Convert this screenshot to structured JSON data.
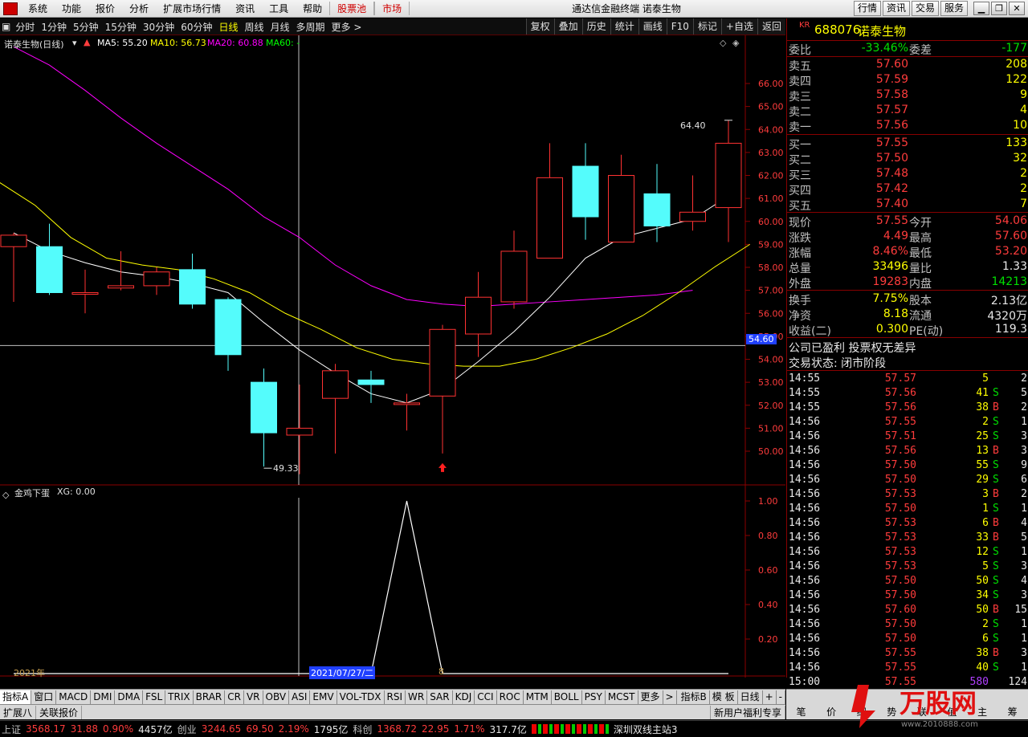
{
  "menu": {
    "items": [
      "系统",
      "功能",
      "报价",
      "分析",
      "扩展市场行情",
      "资讯",
      "工具",
      "帮助"
    ],
    "highlight": [
      "股票池",
      "市场"
    ],
    "app_title": "通达信金融终端  诺泰生物",
    "right_buttons": [
      "行情",
      "资讯",
      "交易",
      "服务"
    ]
  },
  "period_bar": {
    "items": [
      "分时",
      "1分钟",
      "5分钟",
      "15分钟",
      "30分钟",
      "60分钟",
      "日线",
      "周线",
      "月线",
      "多周期",
      "更多 >"
    ],
    "active": "日线",
    "tools": [
      "复权",
      "叠加",
      "历史",
      "统计",
      "画线",
      "F10",
      "标记",
      "+自选",
      "返回"
    ]
  },
  "chart_header": {
    "name": "诺泰生物(日线)",
    "ma5": "MA5: 55.20",
    "ma10": "MA10: 56.73",
    "ma20": "MA20: 60.88",
    "ma60": "MA60: -"
  },
  "indicator_header": {
    "name": "金鸡下蛋",
    "xg": "XG: 0.00"
  },
  "labels": {
    "high_marker": "64.40",
    "low_marker": "49.33",
    "cursor_price": "54.60",
    "year": "2021年",
    "cursor_date": "2021/07/27/二",
    "x_tick": "8",
    "period_label": "日线"
  },
  "colors": {
    "up": "#ff3232",
    "down": "#54fcfc",
    "ma5": "#ffffff",
    "ma10": "#ffff00",
    "ma20": "#ff00ff"
  },
  "chart_data": {
    "type": "candlestick",
    "y_ticks": [
      50.0,
      51.0,
      52.0,
      53.0,
      54.0,
      55.0,
      56.0,
      57.0,
      58.0,
      59.0,
      60.0,
      61.0,
      62.0,
      63.0,
      64.0,
      65.0,
      66.0
    ],
    "candles": [
      {
        "o": 58.9,
        "c": 59.4,
        "h": 59.5,
        "l": 56.5
      },
      {
        "o": 58.9,
        "c": 56.9,
        "h": 59.9,
        "l": 56.8
      },
      {
        "o": 56.9,
        "c": 56.9,
        "h": 57.9,
        "l": 56.0
      },
      {
        "o": 57.1,
        "c": 57.2,
        "h": 58.7,
        "l": 57.0
      },
      {
        "o": 57.2,
        "c": 57.8,
        "h": 58.0,
        "l": 56.8
      },
      {
        "o": 57.9,
        "c": 56.4,
        "h": 58.6,
        "l": 56.2
      },
      {
        "o": 56.6,
        "c": 54.2,
        "h": 56.7,
        "l": 53.5
      },
      {
        "o": 53.0,
        "c": 50.8,
        "h": 53.6,
        "l": 49.33
      },
      {
        "o": 50.7,
        "c": 51.0,
        "h": 52.9,
        "l": 49.0
      },
      {
        "o": 52.3,
        "c": 53.5,
        "h": 53.8,
        "l": 49.9
      },
      {
        "o": 53.1,
        "c": 52.9,
        "h": 53.5,
        "l": 52.1
      },
      {
        "o": 52.1,
        "c": 52.1,
        "h": 52.5,
        "l": 50.9
      },
      {
        "o": 52.4,
        "c": 55.3,
        "h": 55.5,
        "l": 49.9
      },
      {
        "o": 55.1,
        "c": 56.7,
        "h": 57.8,
        "l": 54.1
      },
      {
        "o": 56.5,
        "c": 58.7,
        "h": 59.6,
        "l": 56.2
      },
      {
        "o": 58.4,
        "c": 61.9,
        "h": 63.4,
        "l": 58.4
      },
      {
        "o": 62.4,
        "c": 60.2,
        "h": 63.4,
        "l": 59.2
      },
      {
        "o": 59.1,
        "c": 62.0,
        "h": 62.9,
        "l": 59.1
      },
      {
        "o": 61.2,
        "c": 59.8,
        "h": 62.5,
        "l": 59.1
      },
      {
        "o": 60.0,
        "c": 60.4,
        "h": 62.0,
        "l": 59.6
      },
      {
        "o": 60.6,
        "c": 63.4,
        "h": 64.4,
        "l": 59.1
      }
    ],
    "ma5": [
      59.5,
      58.7,
      58.2,
      57.8,
      57.6,
      57.3,
      56.9,
      55.6,
      54.4,
      53.4,
      52.5,
      52.1,
      52.7,
      53.9,
      55.2,
      56.7,
      58.4,
      59.3,
      59.7,
      60.1,
      61.1
    ],
    "ma10": [
      61.7,
      60.7,
      59.3,
      58.4,
      58.1,
      57.9,
      57.5,
      56.9,
      56.0,
      55.3,
      54.5,
      54.0,
      53.8,
      53.7,
      53.7,
      54.0,
      54.5,
      55.1,
      55.9,
      56.9,
      58.0,
      59.0
    ],
    "ma20": [
      67.6,
      66.8,
      65.7,
      64.5,
      63.4,
      62.4,
      61.4,
      60.2,
      59.3,
      58.1,
      57.2,
      56.6,
      56.4,
      56.3,
      56.4,
      56.5,
      56.6,
      56.7,
      56.8,
      57.0
    ],
    "indicator": {
      "name": "金鸡下蛋",
      "ticks": [
        0.2,
        0.4,
        0.6,
        0.8,
        1.0
      ],
      "values": [
        0,
        0,
        0,
        0,
        0,
        0,
        0,
        0,
        0,
        0,
        0,
        1,
        0,
        0,
        0,
        0,
        0,
        0,
        0,
        0,
        0
      ]
    }
  },
  "quote": {
    "code": "688076",
    "name": "诺泰生物",
    "kr": "KR",
    "weibi_label": "委比",
    "weibi": "-33.46%",
    "weicha_label": "委差",
    "weicha": "-177",
    "asks": [
      {
        "label": "卖五",
        "price": "57.60",
        "vol": "208"
      },
      {
        "label": "卖四",
        "price": "57.59",
        "vol": "122"
      },
      {
        "label": "卖三",
        "price": "57.58",
        "vol": "9"
      },
      {
        "label": "卖二",
        "price": "57.57",
        "vol": "4"
      },
      {
        "label": "卖一",
        "price": "57.56",
        "vol": "10"
      }
    ],
    "bids": [
      {
        "label": "买一",
        "price": "57.55",
        "vol": "133"
      },
      {
        "label": "买二",
        "price": "57.50",
        "vol": "32"
      },
      {
        "label": "买三",
        "price": "57.48",
        "vol": "2"
      },
      {
        "label": "买四",
        "price": "57.42",
        "vol": "2"
      },
      {
        "label": "买五",
        "price": "57.40",
        "vol": "7"
      }
    ],
    "stats": [
      {
        "l1": "现价",
        "v1": "57.55",
        "l2": "今开",
        "v2": "54.06"
      },
      {
        "l1": "涨跌",
        "v1": "4.49",
        "l2": "最高",
        "v2": "57.60"
      },
      {
        "l1": "涨幅",
        "v1": "8.46%",
        "l2": "最低",
        "v2": "53.20"
      },
      {
        "l1": "总量",
        "v1": "33496",
        "l2": "量比",
        "v2": "1.33"
      },
      {
        "l1": "外盘",
        "v1": "19283",
        "l2": "内盘",
        "v2": "14213"
      }
    ],
    "stats2": [
      {
        "l1": "换手",
        "v1": "7.75%",
        "l2": "股本",
        "v2": "2.13亿"
      },
      {
        "l1": "净资",
        "v1": "8.18",
        "l2": "流通",
        "v2": "4320万"
      },
      {
        "l1": "收益(二)",
        "v1": "0.300",
        "l2": "PE(动)",
        "v2": "119.3"
      }
    ],
    "notes": [
      "公司已盈利 投票权无差异",
      "交易状态: 闭市阶段"
    ]
  },
  "ticks": [
    [
      "14:55",
      "57.57",
      "5",
      "",
      "2"
    ],
    [
      "14:55",
      "57.56",
      "41",
      "S",
      "5"
    ],
    [
      "14:55",
      "57.56",
      "38",
      "B",
      "2"
    ],
    [
      "14:56",
      "57.55",
      "2",
      "S",
      "1"
    ],
    [
      "14:56",
      "57.51",
      "25",
      "S",
      "3"
    ],
    [
      "14:56",
      "57.56",
      "13",
      "B",
      "3"
    ],
    [
      "14:56",
      "57.50",
      "55",
      "S",
      "9"
    ],
    [
      "14:56",
      "57.50",
      "29",
      "S",
      "6"
    ],
    [
      "14:56",
      "57.53",
      "3",
      "B",
      "2"
    ],
    [
      "14:56",
      "57.50",
      "1",
      "S",
      "1"
    ],
    [
      "14:56",
      "57.53",
      "6",
      "B",
      "4"
    ],
    [
      "14:56",
      "57.53",
      "33",
      "B",
      "5"
    ],
    [
      "14:56",
      "57.53",
      "12",
      "S",
      "1"
    ],
    [
      "14:56",
      "57.53",
      "5",
      "S",
      "3"
    ],
    [
      "14:56",
      "57.50",
      "50",
      "S",
      "4"
    ],
    [
      "14:56",
      "57.50",
      "34",
      "S",
      "3"
    ],
    [
      "14:56",
      "57.60",
      "50",
      "B",
      "15"
    ],
    [
      "14:56",
      "57.50",
      "2",
      "S",
      "1"
    ],
    [
      "14:56",
      "57.50",
      "6",
      "S",
      "1"
    ],
    [
      "14:56",
      "57.55",
      "38",
      "B",
      "3"
    ],
    [
      "14:56",
      "57.55",
      "40",
      "S",
      "1"
    ],
    [
      "15:00",
      "57.55",
      "580",
      "",
      "124"
    ]
  ],
  "index_tabs": [
    "指标A",
    "窗口",
    "MACD",
    "DMI",
    "DMA",
    "FSL",
    "TRIX",
    "BRAR",
    "CR",
    "VR",
    "OBV",
    "ASI",
    "EMV",
    "VOL-TDX",
    "RSI",
    "WR",
    "SAR",
    "KDJ",
    "CCI",
    "ROC",
    "MTM",
    "BOLL",
    "PSY",
    "MCST",
    "更多",
    ">"
  ],
  "index_right": [
    "指标B",
    "模 板",
    "日线",
    "+",
    "-"
  ],
  "bottom_left": [
    "扩展八",
    "关联报价"
  ],
  "bottom_right": "新用户福利专享",
  "right_tabs": [
    "笔",
    "价",
    "细",
    "势",
    "联",
    "值",
    "主",
    "筹"
  ],
  "status": {
    "sh_label": "上证",
    "sh": "3568.17",
    "sh_chg": "31.88",
    "sh_pct": "0.90%",
    "sh_amt": "4457亿",
    "cy_label": "创业",
    "cy": "3244.65",
    "cy_chg": "69.50",
    "cy_pct": "2.19%",
    "cy_amt": "1795亿",
    "kc_label": "科创",
    "kc": "1368.72",
    "kc_chg": "22.95",
    "kc_pct": "1.71%",
    "kc_amt": "317.7亿",
    "server": "深圳双线主站3"
  },
  "watermark": {
    "brand": "万股网",
    "url": "www.2010888.com"
  }
}
